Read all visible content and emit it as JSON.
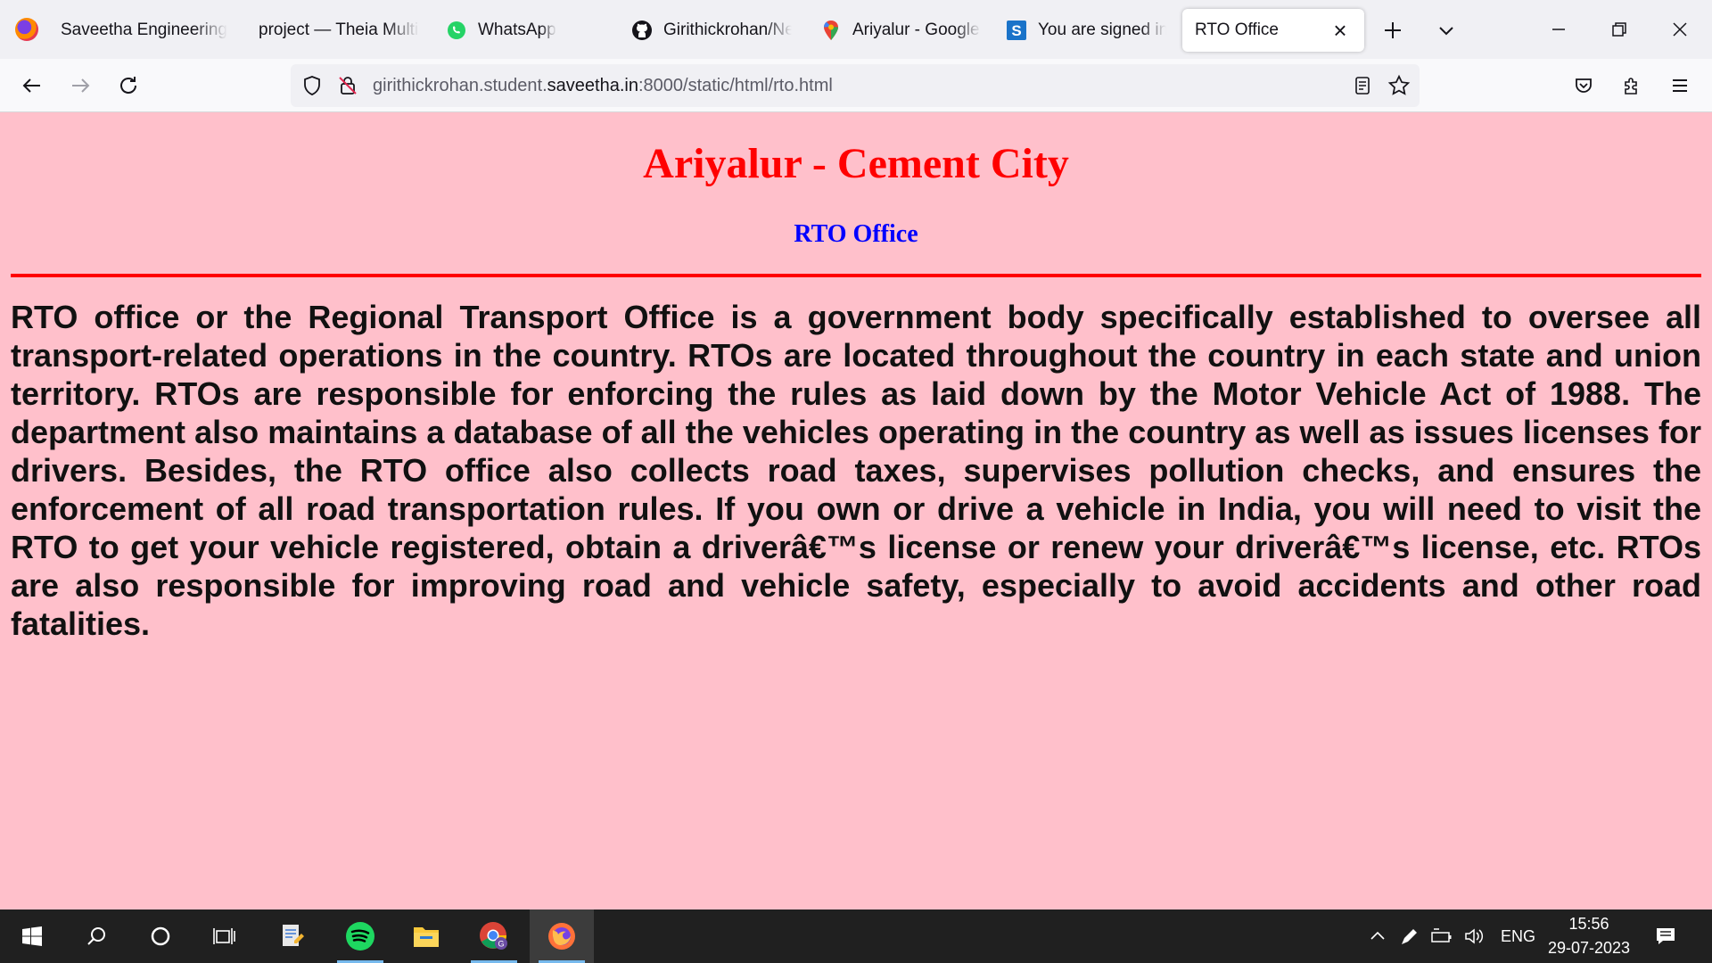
{
  "browser": {
    "tabs": [
      {
        "title": "Saveetha Engineering",
        "icon": "saveetha-icon"
      },
      {
        "title": "project — Theia Multi-",
        "icon": "theia-icon"
      },
      {
        "title": "WhatsApp",
        "icon": "whatsapp-icon"
      },
      {
        "title": "Girithickrohan/Ne",
        "icon": "github-icon"
      },
      {
        "title": "Ariyalur - Google M",
        "icon": "google-maps-icon"
      },
      {
        "title": "You are signed in as",
        "icon": "s-icon"
      },
      {
        "title": "RTO Office",
        "icon": "none",
        "active": true
      }
    ],
    "url": {
      "prefix": "girithickrohan.student.",
      "domain": "saveetha.in",
      "suffix": ":8000/static/html/rto.html"
    }
  },
  "page": {
    "title": "Ariyalur - Cement City",
    "subtitle": "RTO Office",
    "body": "RTO office or the Regional Transport Office is a government body specifically established to oversee all transport-related operations in the country. RTOs are located throughout the country in each state and union territory. RTOs are responsible for enforcing the rules as laid down by the Motor Vehicle Act of 1988. The department also maintains a database of all the vehicles operating in the country as well as issues licenses for drivers. Besides, the RTO office also collects road taxes, supervises pollution checks, and ensures the enforcement of all road transportation rules. If you own or drive a vehicle in India, you will need to visit the RTO to get your vehicle registered, obtain a driverâ€™s license or renew your driverâ€™s license, etc. RTOs are also responsible for improving road and vehicle safety, especially to avoid accidents and other road fatalities."
  },
  "colors": {
    "page_background": "#ffc0cb",
    "title": "#ff0000",
    "subtitle": "#0000ff",
    "rule": "#ff0000"
  },
  "taskbar": {
    "language": "ENG",
    "time": "15:56",
    "date": "29-07-2023"
  }
}
